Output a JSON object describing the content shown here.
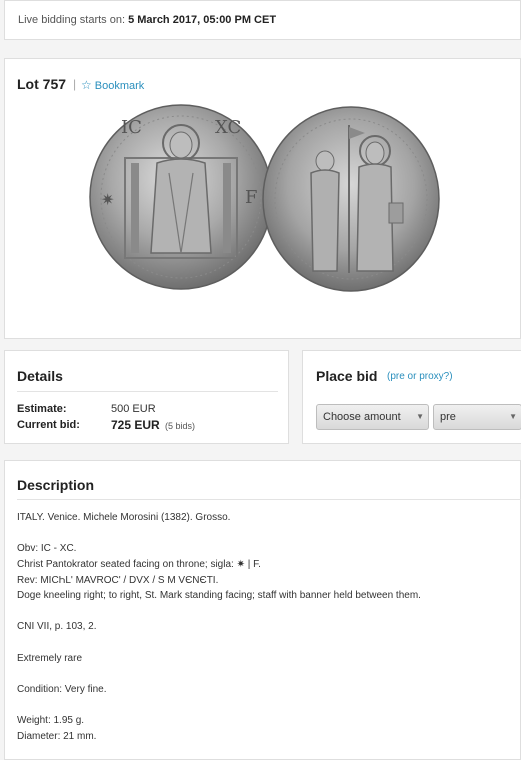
{
  "live": {
    "label": "Live bidding starts on:",
    "date": "5 March 2017, 05:00 PM CET"
  },
  "lot": {
    "title": "Lot 757",
    "separator": "|",
    "bookmark_icon": "star-icon",
    "bookmark_label": "Bookmark",
    "image": "silver coin obverse and reverse (Venice grosso)"
  },
  "details": {
    "title": "Details",
    "estimate_label": "Estimate:",
    "estimate_value": "500 EUR",
    "current_bid_label": "Current bid:",
    "current_bid_value": "725 EUR",
    "bids_count": "(5 bids)"
  },
  "bid": {
    "title": "Place bid",
    "help_link": "(pre or proxy?)",
    "amount_select": "Choose amount",
    "mode_select": "pre"
  },
  "description": {
    "title": "Description",
    "lines": [
      "ITALY. Venice. Michele Morosini (1382). Grosso.",
      "Obv: IC - XC.",
      "Christ Pantokrator seated facing on throne; sigla: ✷ | F.",
      "Rev: MICҺL' MAVROC' / DVX / S M VЄNЄTI.",
      "Doge kneeling right; to right, St. Mark standing facing; staff with banner held between them.",
      "CNI VII, p. 103, 2.",
      "Extremely rare",
      "Condition: Very fine.",
      "Weight: 1.95 g.",
      "Diameter: 21 mm."
    ]
  },
  "colors": {
    "link": "#2a8fbd",
    "card_border": "#dedede",
    "page_bg": "#f4f4f4"
  }
}
